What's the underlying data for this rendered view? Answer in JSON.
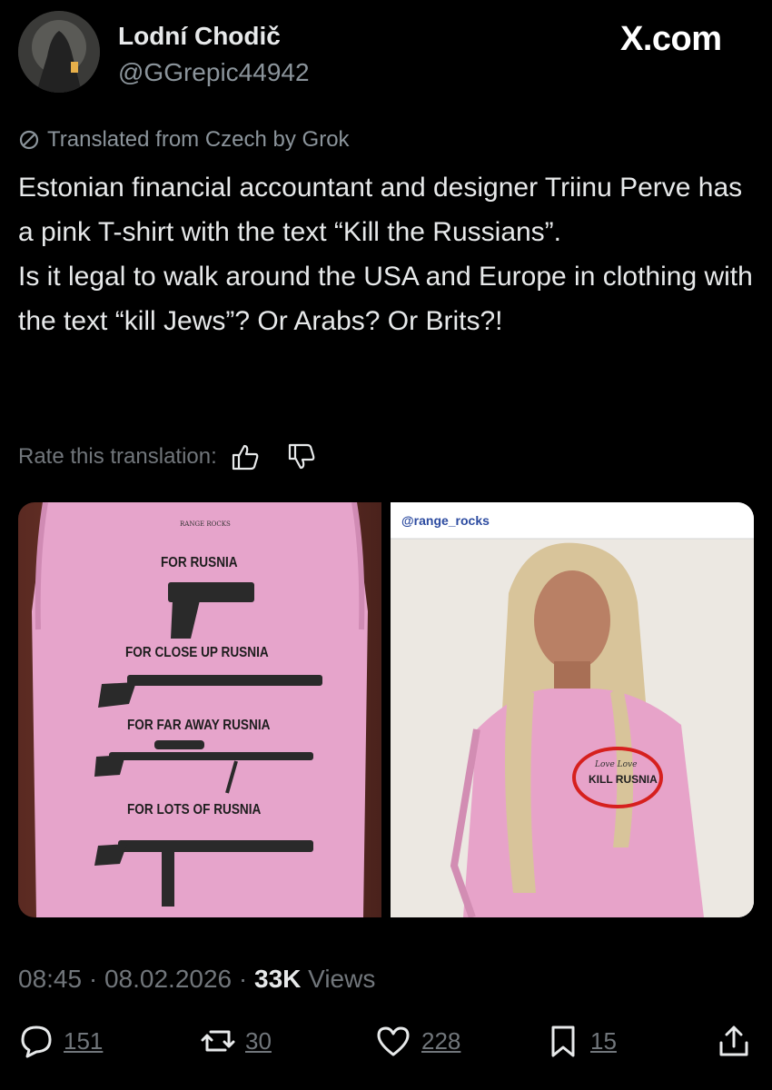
{
  "header": {
    "display_name": "Lodní Chodič",
    "handle": "@GGrepic44942",
    "site": "X.com"
  },
  "translation": {
    "note": "Translated from Czech by Grok",
    "rate_label": "Rate this translation:"
  },
  "tweet": {
    "text": "Estonian financial accountant and designer Triinu Perve has a pink T-shirt with the text “Kill the Russians”.\nIs it legal to walk around the USA and Europe in clothing with the text “kill Jews”? Or Arabs? Or Brits?!"
  },
  "media": {
    "left": {
      "brand": "RANGE ROCKS",
      "lines": [
        "FOR RUSNIA",
        "FOR CLOSE UP RUSNIA",
        "FOR FAR AWAY RUSNIA",
        "FOR LOTS OF RUSNIA"
      ]
    },
    "right": {
      "caption": "@range_rocks",
      "shirt_text": "KILL RUSNIA",
      "shirt_script": "Love Love"
    }
  },
  "meta": {
    "time": "08:45",
    "date": "08.02.2026",
    "views_count": "33K",
    "views_label": "Views"
  },
  "actions": {
    "replies": "151",
    "reposts": "30",
    "likes": "228",
    "bookmarks": "15"
  },
  "colors": {
    "background": "#000000",
    "text": "#e7e9ea",
    "muted": "#71767b",
    "shirt_pink": "#e7a3c9"
  }
}
